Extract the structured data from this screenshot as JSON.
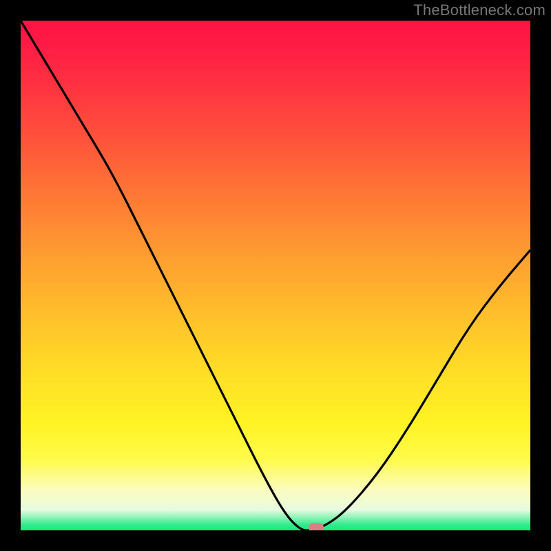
{
  "watermark": "TheBottleneck.com",
  "colors": {
    "frame": "#000000",
    "curve": "#000000",
    "marker": "#d98084",
    "gradient_top": "#ff1244",
    "gradient_bottom": "#16e97e"
  },
  "chart_data": {
    "type": "line",
    "title": "",
    "xlabel": "",
    "ylabel": "",
    "xlim": [
      0,
      100
    ],
    "ylim": [
      0,
      100
    ],
    "notes": "V-shaped bottleneck curve. Y value = bottleneck severity (0 at bottom/green = no bottleneck, 100 at top/red = severe). Minimum occurs around x≈57.",
    "x": [
      0,
      6,
      12,
      18,
      24,
      30,
      36,
      42,
      48,
      52,
      55,
      57,
      60,
      64,
      70,
      76,
      82,
      88,
      94,
      100
    ],
    "values": [
      100,
      90,
      80,
      70,
      58,
      46,
      34,
      22,
      10,
      3,
      0,
      0,
      1,
      4,
      11,
      20,
      30,
      40,
      48,
      55
    ],
    "marker": {
      "x": 58,
      "y": 0.5
    }
  }
}
